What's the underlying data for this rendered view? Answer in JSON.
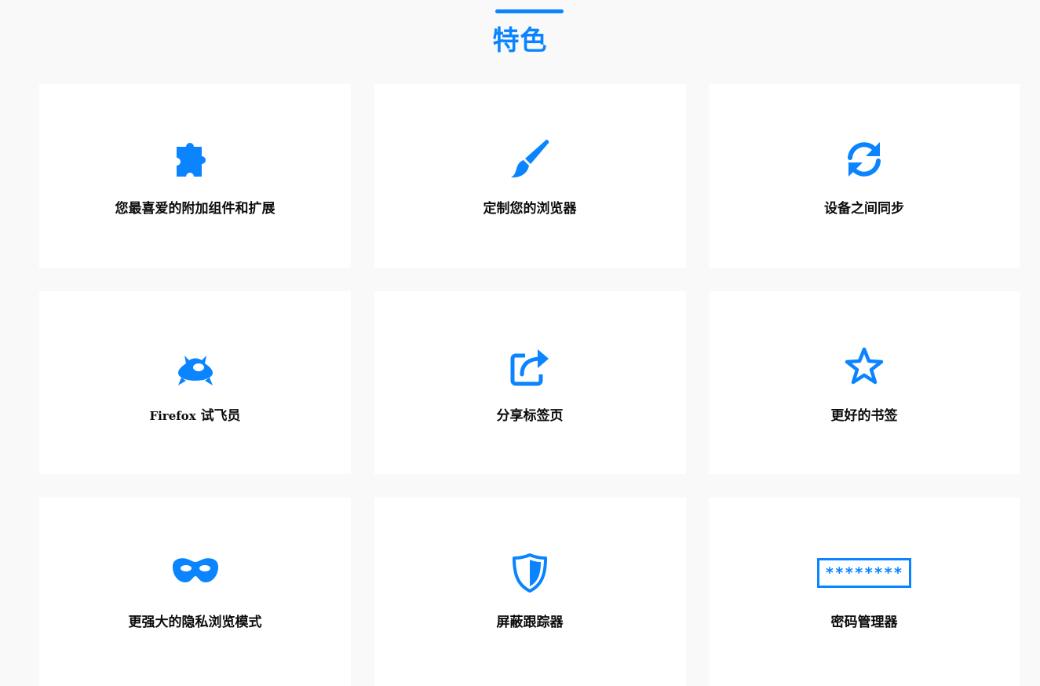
{
  "section": {
    "title": "特色",
    "accent_color": "#0a84ff"
  },
  "features": [
    {
      "label": "您最喜爱的附加组件和扩展",
      "icon": "puzzle-icon"
    },
    {
      "label": "定制您的浏览器",
      "icon": "paintbrush-icon"
    },
    {
      "label": "设备之间同步",
      "icon": "sync-icon"
    },
    {
      "label_latin": "Firefox",
      "label": "试飞员",
      "icon": "ufo-icon"
    },
    {
      "label": "分享标签页",
      "icon": "share-icon"
    },
    {
      "label": "更好的书签",
      "icon": "star-icon"
    },
    {
      "label": "更强大的隐私浏览模式",
      "icon": "mask-icon"
    },
    {
      "label": "屏蔽跟踪器",
      "icon": "shield-icon"
    },
    {
      "label": "密码管理器",
      "icon": "password-icon",
      "icon_text": "********"
    }
  ]
}
